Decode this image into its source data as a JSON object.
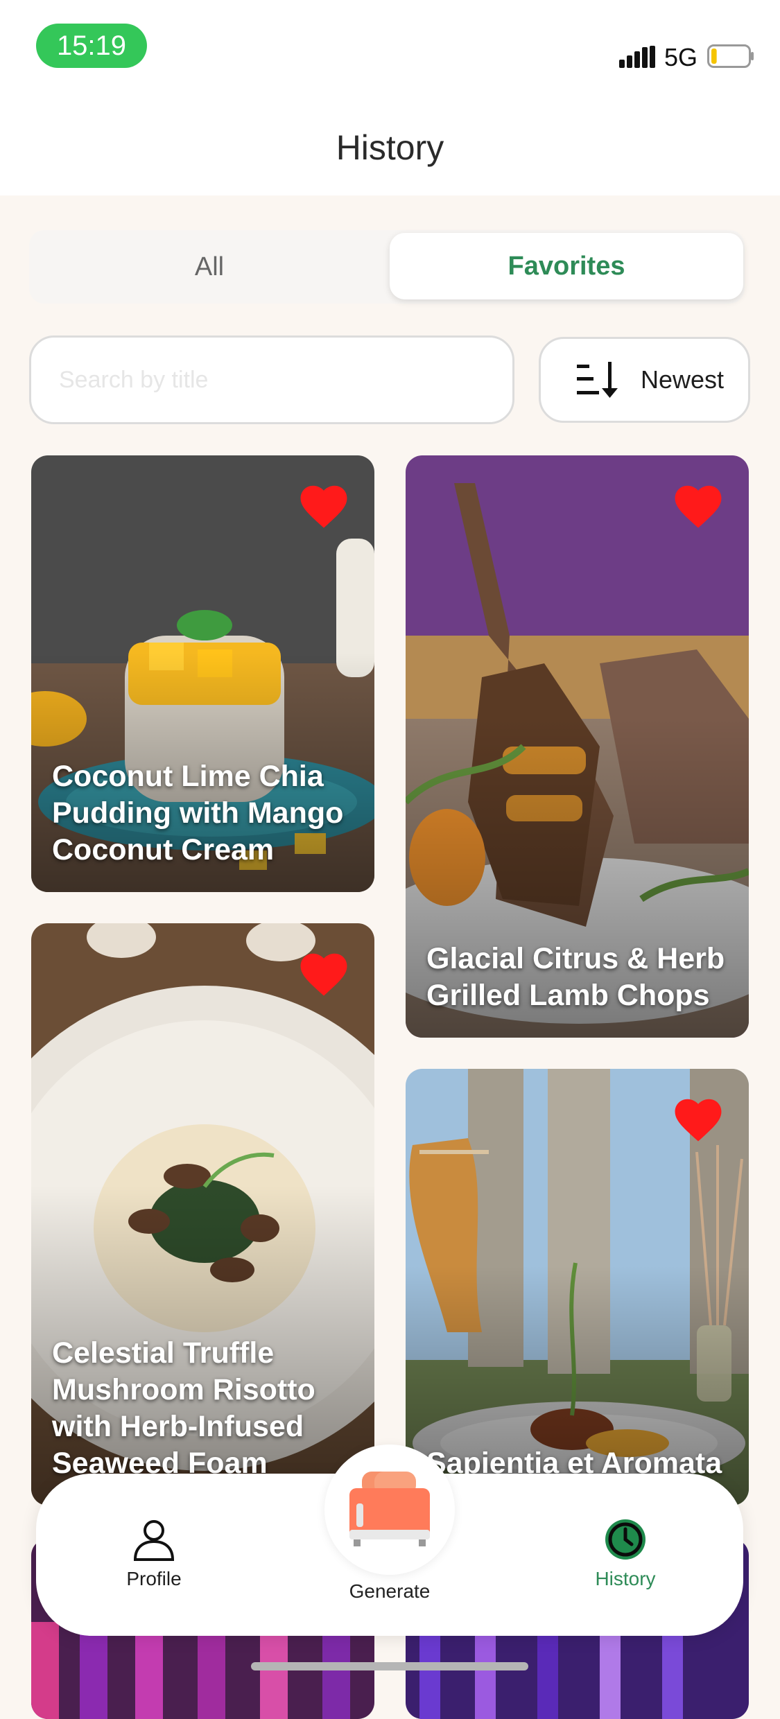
{
  "status_bar": {
    "time": "15:19",
    "network": "5G",
    "battery_level": 0.15
  },
  "header": {
    "title": "History"
  },
  "tabs": {
    "all_label": "All",
    "favorites_label": "Favorites",
    "selected": "Favorites"
  },
  "search": {
    "placeholder": "Search by title",
    "value": ""
  },
  "sort": {
    "label": "Newest",
    "icon": "sort-descending-icon"
  },
  "recipes": [
    {
      "title": "Coconut Lime Chia Pudding with Mango Coconut Cream",
      "favorite": true
    },
    {
      "title": "Glacial Citrus & Herb Grilled Lamb Chops",
      "favorite": true
    },
    {
      "title": "Celestial Truffle Mushroom Risotto with Herb-Infused Seaweed Foam",
      "favorite": true
    },
    {
      "title": "Sapientia et Aromata",
      "favorite": true
    }
  ],
  "bottom_nav": {
    "profile_label": "Profile",
    "generate_label": "Generate",
    "history_label": "History",
    "active": "History"
  },
  "colors": {
    "accent_green": "#2e8b57",
    "status_green": "#34c759",
    "heart_red": "#ff1a1a",
    "background": "#fbf6f1"
  }
}
